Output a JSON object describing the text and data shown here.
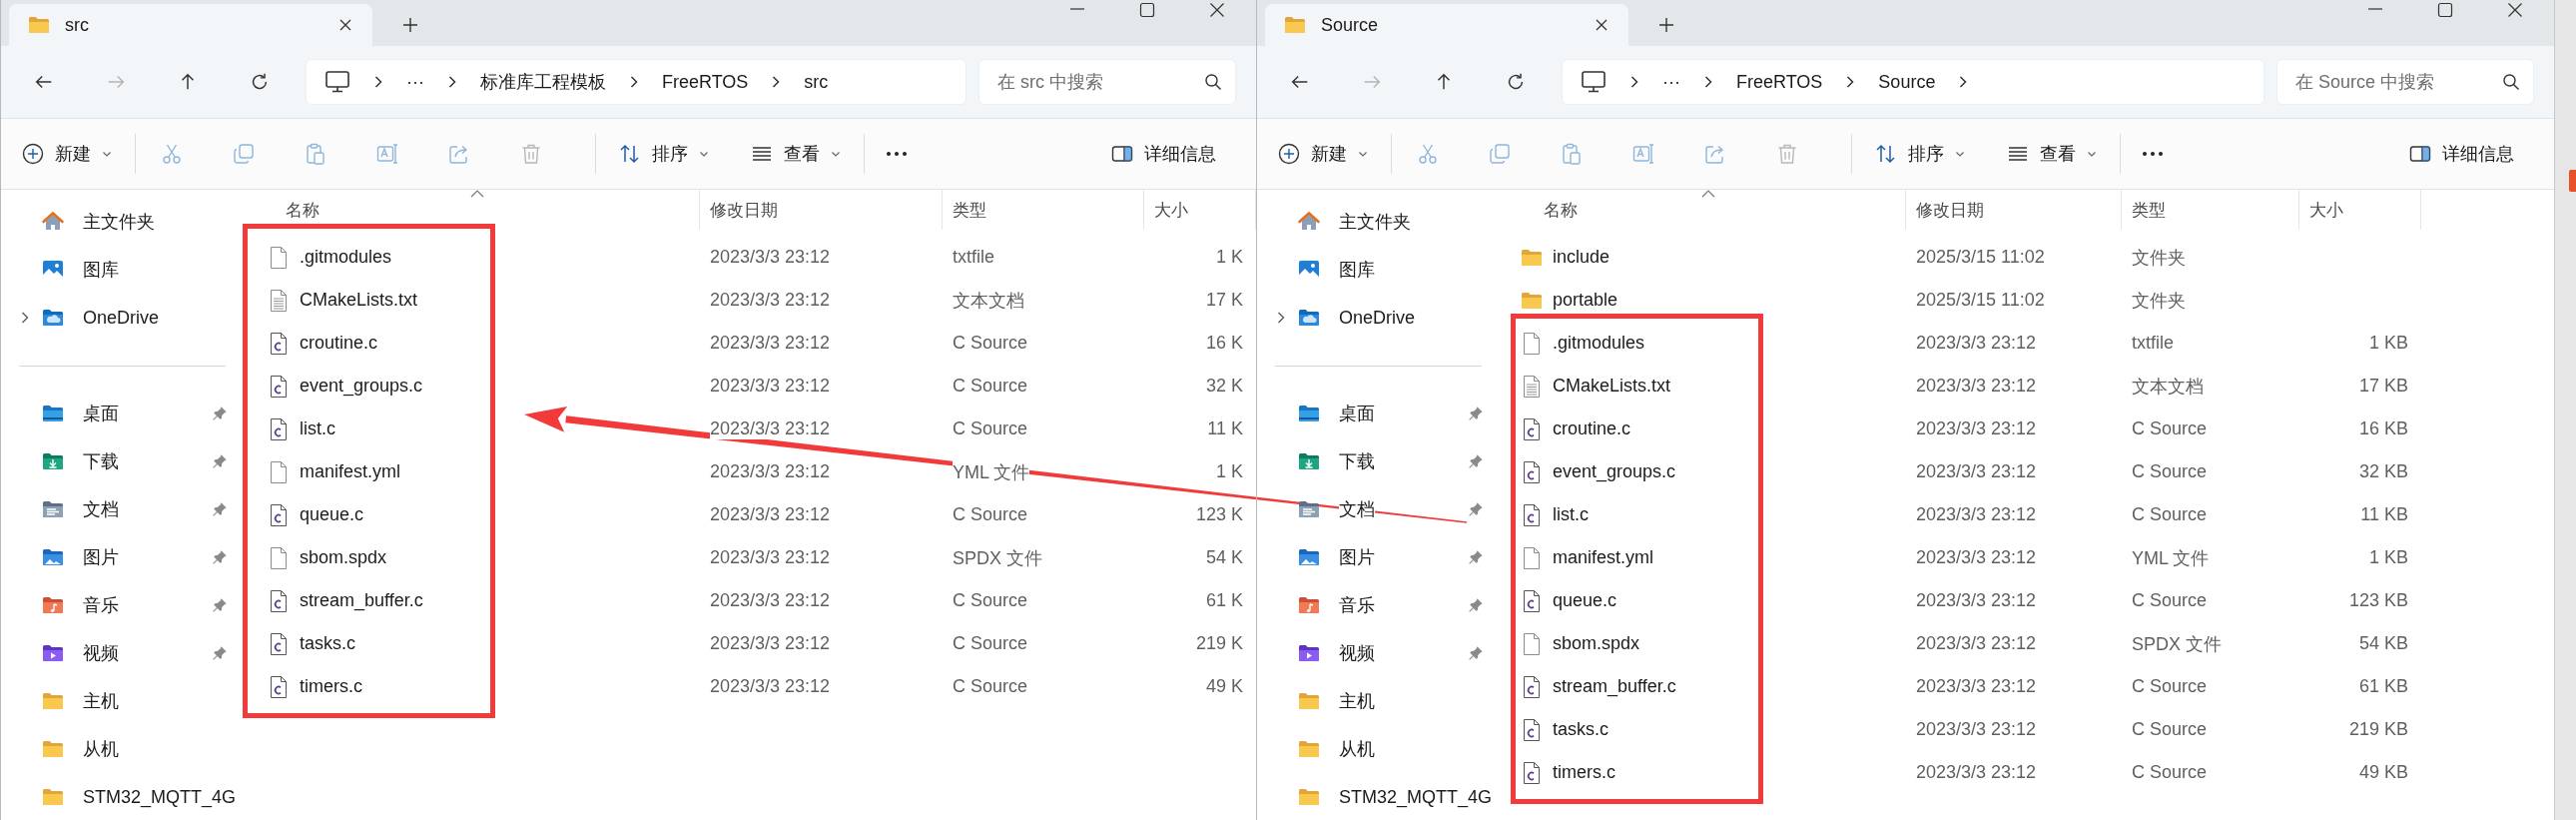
{
  "windows": [
    {
      "tab_title": "src",
      "nav_buttons": [
        {
          "kind": "back",
          "disabled": false
        },
        {
          "kind": "forward",
          "disabled": true
        },
        {
          "kind": "up",
          "disabled": false
        },
        {
          "kind": "refresh",
          "disabled": false
        }
      ],
      "breadcrumb": [
        "···",
        "标准库工程模板",
        "FreeRTOS",
        "src"
      ],
      "breadcrumb_trailing_chevron": false,
      "search": {
        "placeholder": "在 src 中搜索"
      },
      "toolbar": {
        "new_label": "新建",
        "actions": [
          {
            "kind": "cut",
            "disabled": true
          },
          {
            "kind": "copy",
            "disabled": true
          },
          {
            "kind": "paste",
            "disabled": true
          },
          {
            "kind": "rename",
            "disabled": true
          },
          {
            "kind": "share",
            "disabled": true
          },
          {
            "kind": "delete",
            "disabled": true
          }
        ],
        "sort_label": "排序",
        "view_label": "查看",
        "details_label": "详细信息"
      },
      "nav": {
        "top": [
          {
            "label": "主文件夹",
            "kind": "home",
            "expandable": false
          },
          {
            "label": "图库",
            "kind": "gallery",
            "expandable": false
          },
          {
            "label": "OneDrive",
            "kind": "cloud",
            "expandable": true
          }
        ],
        "quick": [
          {
            "label": "桌面",
            "kind": "desktop",
            "pinned": true
          },
          {
            "label": "下载",
            "kind": "download",
            "pinned": true
          },
          {
            "label": "文档",
            "kind": "documents",
            "pinned": true
          },
          {
            "label": "图片",
            "kind": "pictures",
            "pinned": true
          },
          {
            "label": "音乐",
            "kind": "music",
            "pinned": true
          },
          {
            "label": "视频",
            "kind": "videos",
            "pinned": true
          },
          {
            "label": "主机",
            "kind": "folder",
            "pinned": false
          },
          {
            "label": "从机",
            "kind": "folder",
            "pinned": false
          },
          {
            "label": "STM32_MQTT_4G",
            "kind": "folder",
            "pinned": false
          }
        ]
      },
      "columns": [
        "名称",
        "修改日期",
        "类型",
        "大小"
      ],
      "boxed_rows": [
        {
          "name": ".gitmodules",
          "kind": "blank",
          "date": "2023/3/3 23:12",
          "type": "txtfile",
          "size": "1 K"
        },
        {
          "name": "CMakeLists.txt",
          "kind": "text",
          "date": "2023/3/3 23:12",
          "type": "文本文档",
          "size": "17 K"
        },
        {
          "name": "croutine.c",
          "kind": "c",
          "date": "2023/3/3 23:12",
          "type": "C Source",
          "size": "16 K"
        },
        {
          "name": "event_groups.c",
          "kind": "c",
          "date": "2023/3/3 23:12",
          "type": "C Source",
          "size": "32 K"
        },
        {
          "name": "list.c",
          "kind": "c",
          "date": "2023/3/3 23:12",
          "type": "C Source",
          "size": "11 K"
        },
        {
          "name": "manifest.yml",
          "kind": "blank",
          "date": "2023/3/3 23:12",
          "type": "YML 文件",
          "size": "1 K"
        },
        {
          "name": "queue.c",
          "kind": "c",
          "date": "2023/3/3 23:12",
          "type": "C Source",
          "size": "123 K"
        },
        {
          "name": "sbom.spdx",
          "kind": "blank",
          "date": "2023/3/3 23:12",
          "type": "SPDX 文件",
          "size": "54 K"
        },
        {
          "name": "stream_buffer.c",
          "kind": "c",
          "date": "2023/3/3 23:12",
          "type": "C Source",
          "size": "61 K"
        },
        {
          "name": "tasks.c",
          "kind": "c",
          "date": "2023/3/3 23:12",
          "type": "C Source",
          "size": "219 K"
        },
        {
          "name": "timers.c",
          "kind": "c",
          "date": "2023/3/3 23:12",
          "type": "C Source",
          "size": "49 K"
        }
      ]
    },
    {
      "tab_title": "Source",
      "nav_buttons": [
        {
          "kind": "back",
          "disabled": false
        },
        {
          "kind": "forward",
          "disabled": true
        },
        {
          "kind": "up",
          "disabled": false
        },
        {
          "kind": "refresh",
          "disabled": false
        }
      ],
      "breadcrumb": [
        "···",
        "FreeRTOS",
        "Source"
      ],
      "breadcrumb_trailing_chevron": true,
      "search": {
        "placeholder": "在 Source 中搜索"
      },
      "toolbar": {
        "new_label": "新建",
        "actions": [
          {
            "kind": "cut",
            "disabled": true
          },
          {
            "kind": "copy",
            "disabled": true
          },
          {
            "kind": "paste",
            "disabled": true
          },
          {
            "kind": "rename",
            "disabled": true
          },
          {
            "kind": "share",
            "disabled": true
          },
          {
            "kind": "delete",
            "disabled": true
          }
        ],
        "sort_label": "排序",
        "view_label": "查看",
        "details_label": "详细信息"
      },
      "nav": {
        "top": [
          {
            "label": "主文件夹",
            "kind": "home",
            "expandable": false
          },
          {
            "label": "图库",
            "kind": "gallery",
            "expandable": false
          },
          {
            "label": "OneDrive",
            "kind": "cloud",
            "expandable": true
          }
        ],
        "quick": [
          {
            "label": "桌面",
            "kind": "desktop",
            "pinned": true
          },
          {
            "label": "下载",
            "kind": "download",
            "pinned": true
          },
          {
            "label": "文档",
            "kind": "documents",
            "pinned": true
          },
          {
            "label": "图片",
            "kind": "pictures",
            "pinned": true
          },
          {
            "label": "音乐",
            "kind": "music",
            "pinned": true
          },
          {
            "label": "视频",
            "kind": "videos",
            "pinned": true
          },
          {
            "label": "主机",
            "kind": "folder",
            "pinned": false
          },
          {
            "label": "从机",
            "kind": "folder",
            "pinned": false
          },
          {
            "label": "STM32_MQTT_4G",
            "kind": "folder",
            "pinned": false
          }
        ]
      },
      "columns": [
        "名称",
        "修改日期",
        "类型",
        "大小"
      ],
      "rows": [
        {
          "name": "include",
          "kind": "folder",
          "date": "2025/3/15 11:02",
          "type": "文件夹"
        },
        {
          "name": "portable",
          "kind": "folder",
          "date": "2025/3/15 11:02",
          "type": "文件夹"
        }
      ],
      "boxed_rows": [
        {
          "name": ".gitmodules",
          "kind": "blank",
          "date": "2023/3/3 23:12",
          "type": "txtfile",
          "size": "1 KB"
        },
        {
          "name": "CMakeLists.txt",
          "kind": "text",
          "date": "2023/3/3 23:12",
          "type": "文本文档",
          "size": "17 KB"
        },
        {
          "name": "croutine.c",
          "kind": "c",
          "date": "2023/3/3 23:12",
          "type": "C Source",
          "size": "16 KB"
        },
        {
          "name": "event_groups.c",
          "kind": "c",
          "date": "2023/3/3 23:12",
          "type": "C Source",
          "size": "32 KB"
        },
        {
          "name": "list.c",
          "kind": "c",
          "date": "2023/3/3 23:12",
          "type": "C Source",
          "size": "11 KB"
        },
        {
          "name": "manifest.yml",
          "kind": "blank",
          "date": "2023/3/3 23:12",
          "type": "YML 文件",
          "size": "1 KB"
        },
        {
          "name": "queue.c",
          "kind": "c",
          "date": "2023/3/3 23:12",
          "type": "C Source",
          "size": "123 KB"
        },
        {
          "name": "sbom.spdx",
          "kind": "blank",
          "date": "2023/3/3 23:12",
          "type": "SPDX 文件",
          "size": "54 KB"
        },
        {
          "name": "stream_buffer.c",
          "kind": "c",
          "date": "2023/3/3 23:12",
          "type": "C Source",
          "size": "61 KB"
        },
        {
          "name": "tasks.c",
          "kind": "c",
          "date": "2023/3/3 23:12",
          "type": "C Source",
          "size": "219 KB"
        },
        {
          "name": "timers.c",
          "kind": "c",
          "date": "2023/3/3 23:12",
          "type": "C Source",
          "size": "49 KB"
        }
      ]
    }
  ],
  "annotation": {
    "arrow_shown": true
  }
}
